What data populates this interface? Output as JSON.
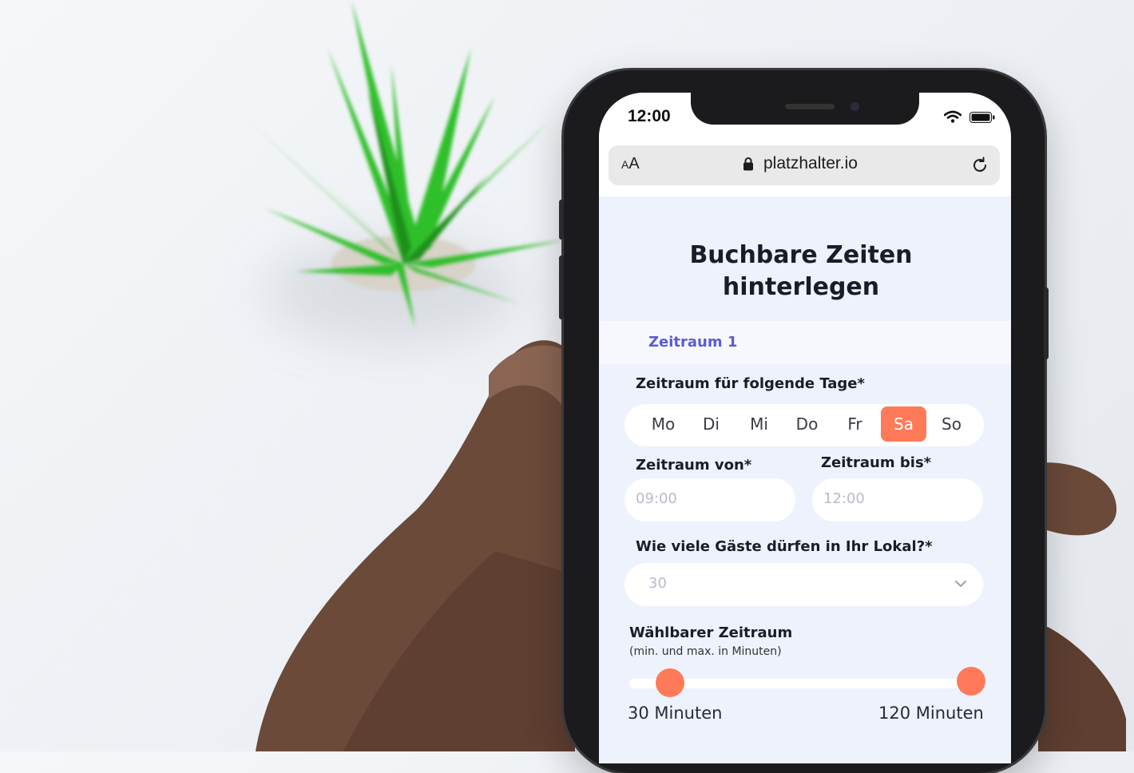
{
  "colors": {
    "accent": "#ff7a59",
    "section_label": "#5b5bd6",
    "screen_bg": "#eef2fc"
  },
  "status_bar": {
    "time": "12:00",
    "icons": [
      "wifi-icon",
      "battery-icon"
    ]
  },
  "browser": {
    "text_size_small": "A",
    "text_size_large": "A",
    "domain": "platzhalter.io",
    "icons": [
      "lock-icon",
      "reload-icon"
    ]
  },
  "page": {
    "title_line1": "Buchbare Zeiten",
    "title_line2": "hinterlegen"
  },
  "section": {
    "label": "Zeitraum 1"
  },
  "days": {
    "label": "Zeitraum für folgende Tage*",
    "items": [
      {
        "label": "Mo",
        "selected": false
      },
      {
        "label": "Di",
        "selected": false
      },
      {
        "label": "Mi",
        "selected": false
      },
      {
        "label": "Do",
        "selected": false
      },
      {
        "label": "Fr",
        "selected": false
      },
      {
        "label": "Sa",
        "selected": true
      },
      {
        "label": "So",
        "selected": false
      }
    ]
  },
  "time_from": {
    "label": "Zeitraum von*",
    "value": "09:00"
  },
  "time_to": {
    "label": "Zeitraum bis*",
    "value": "12:00"
  },
  "guests": {
    "label": "Wie viele Gäste dürfen in Ihr Lokal?*",
    "selected": "30",
    "icon": "chevron-down-icon"
  },
  "range": {
    "label": "Wählbarer Zeitraum",
    "hint": "(min. und max. in Minuten)",
    "min_label": "30 Minuten",
    "max_label": "120 Minuten",
    "min_value": 30,
    "max_value": 120
  }
}
